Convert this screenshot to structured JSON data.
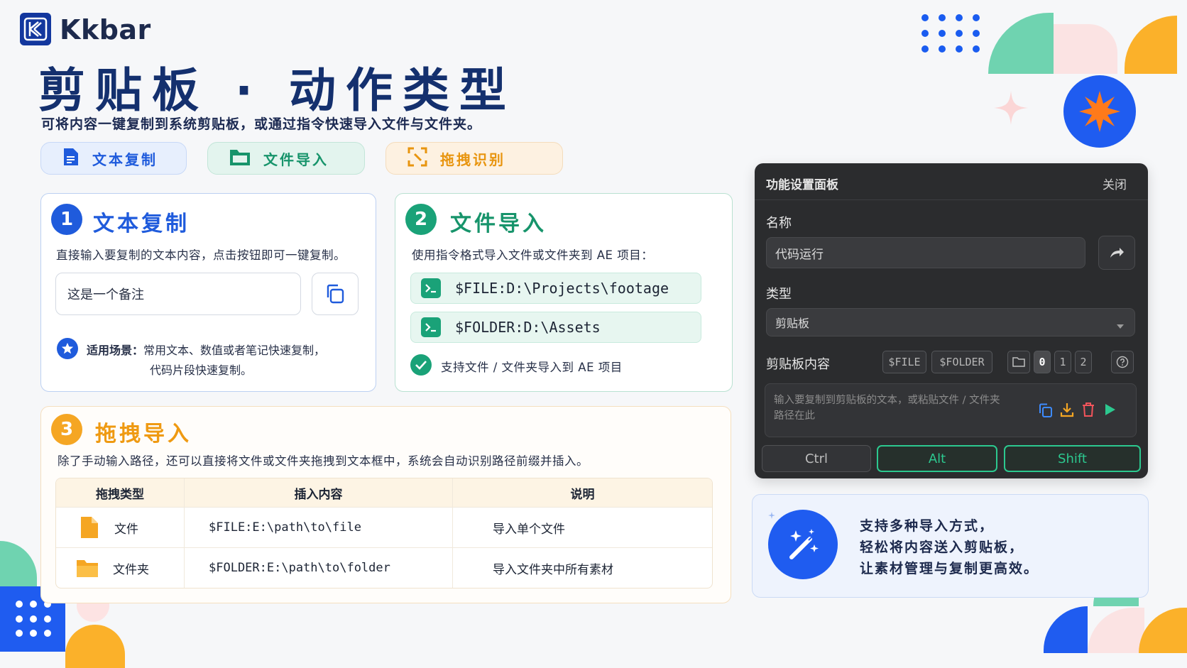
{
  "brand": {
    "name": "Kkbar"
  },
  "header": {
    "title": "剪贴板 · 动作类型",
    "subtitle": "可将内容一键复制到系统剪贴板，或通过指令快速导入文件与文件夹。"
  },
  "pills": [
    {
      "label": "文本复制",
      "icon": "document-icon"
    },
    {
      "label": "文件导入",
      "icon": "folder-icon"
    },
    {
      "label": "拖拽识别",
      "icon": "drag-select-icon"
    }
  ],
  "card1": {
    "number": "1",
    "title": "文本复制",
    "desc": "直接输入要复制的文本内容，点击按钮即可一键复制。",
    "input_value": "这是一个备注",
    "scene_label": "适用场景：",
    "scene_text_1": "常用文本、数值或者笔记快速复制，",
    "scene_text_2": "代码片段快速复制。"
  },
  "card2": {
    "number": "2",
    "title": "文件导入",
    "desc": "使用指令格式导入文件或文件夹到 AE 项目：",
    "commands": [
      "$FILE:D:\\Projects\\footage",
      "$FOLDER:D:\\Assets"
    ],
    "support": "支持文件 / 文件夹导入到 AE 项目"
  },
  "card3": {
    "number": "3",
    "title": "拖拽导入",
    "desc": "除了手动输入路径，还可以直接将文件或文件夹拖拽到文本框中，系统会自动识别路径前缀并插入。",
    "table": {
      "headers": [
        "拖拽类型",
        "插入内容",
        "说明"
      ],
      "rows": [
        {
          "type": "文件",
          "icon": "file-icon",
          "content": "$FILE:E:\\path\\to\\file",
          "desc": "导入单个文件"
        },
        {
          "type": "文件夹",
          "icon": "folder-icon",
          "content": "$FOLDER:E:\\path\\to\\folder",
          "desc": "导入文件夹中所有素材"
        }
      ]
    }
  },
  "panel": {
    "title": "功能设置面板",
    "close": "关闭",
    "name_label": "名称",
    "name_value": "代码运行",
    "type_label": "类型",
    "type_value": "剪贴板",
    "content_label": "剪贴板内容",
    "tags": [
      "$FILE",
      "$FOLDER"
    ],
    "slots": [
      "0",
      "1",
      "2"
    ],
    "placeholder_1": "输入要复制到剪贴板的文本，或粘贴文件 / 文件夹",
    "placeholder_2": "路径在此",
    "keys": [
      "Ctrl",
      "Alt",
      "Shift"
    ]
  },
  "info": {
    "lines": [
      "支持多种导入方式，",
      "轻松将内容送入剪贴板，",
      "让素材管理与复制更高效。"
    ]
  },
  "colors": {
    "blue": "#1f5bdc",
    "green": "#1aa278",
    "orange": "#f5a623",
    "dark_panel": "#2b2c2e",
    "title_navy": "#14306e"
  }
}
